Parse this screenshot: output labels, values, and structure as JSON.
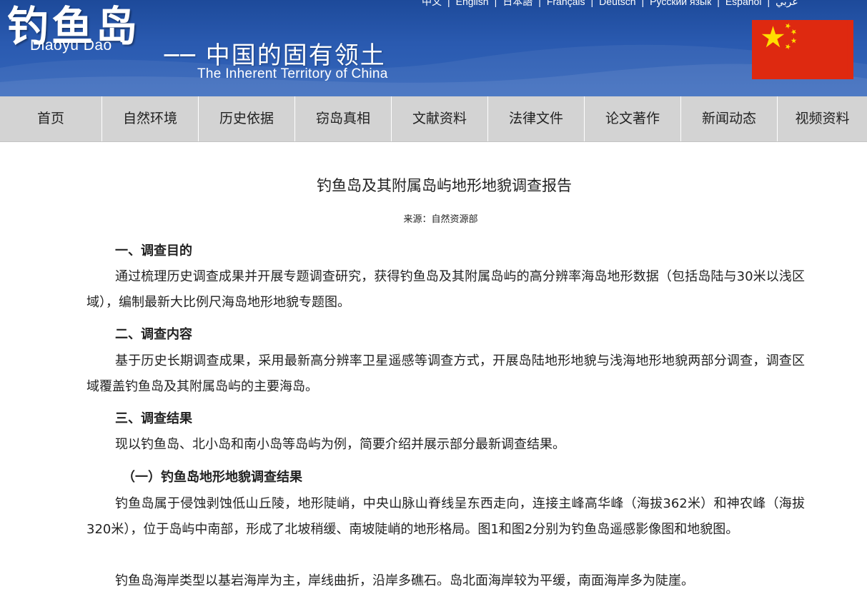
{
  "header": {
    "logo_cn": "钓鱼岛",
    "logo_en": "Diaoyu Dao",
    "slogan_cn": "── 中国的固有领土",
    "slogan_en": "The Inherent Territory of China",
    "languages": [
      "中文",
      "English",
      "日本語",
      "Français",
      "Deutsch",
      "Русский язык",
      "Español",
      "عربي"
    ],
    "flag_colors": {
      "red": "#de2910",
      "yellow": "#ffde00"
    }
  },
  "nav": {
    "items": [
      "首页",
      "自然环境",
      "历史依据",
      "窃岛真相",
      "文献资料",
      "法律文件",
      "论文著作",
      "新闻动态",
      "视频资料"
    ]
  },
  "article": {
    "title": "钓鱼岛及其附属岛屿地形地貌调查报告",
    "source": "来源：自然资源部",
    "section1_heading": "一、调查目的",
    "section1_text": "通过梳理历史调查成果并开展专题调查研究，获得钓鱼岛及其附属岛屿的高分辨率海岛地形数据（包括岛陆与30米以浅区域），编制最新大比例尺海岛地形地貌专题图。",
    "section2_heading": "二、调查内容",
    "section2_text": "基于历史长期调查成果，采用最新高分辨率卫星遥感等调查方式，开展岛陆地形地貌与浅海地形地貌两部分调查，调查区域覆盖钓鱼岛及其附属岛屿的主要海岛。",
    "section3_heading": "三、调查结果",
    "section3_text": "现以钓鱼岛、北小岛和南小岛等岛屿为例，简要介绍并展示部分最新调查结果。",
    "subsection1_heading": "（一）钓鱼岛地形地貌调查结果",
    "subsection1_text": "钓鱼岛属于侵蚀剥蚀低山丘陵，地形陡峭，中央山脉山脊线呈东西走向，连接主峰高华峰（海拔362米）和神农峰（海拔320米），位于岛屿中南部，形成了北坡稍缓、南坡陡峭的地形格局。图1和图2分别为钓鱼岛遥感影像图和地貌图。",
    "next_text": "钓鱼岛海岸类型以基岩海岸为主，岸线曲折，沿岸多礁石。岛北面海岸较为平缓，南面海岸多为陡崖。"
  }
}
